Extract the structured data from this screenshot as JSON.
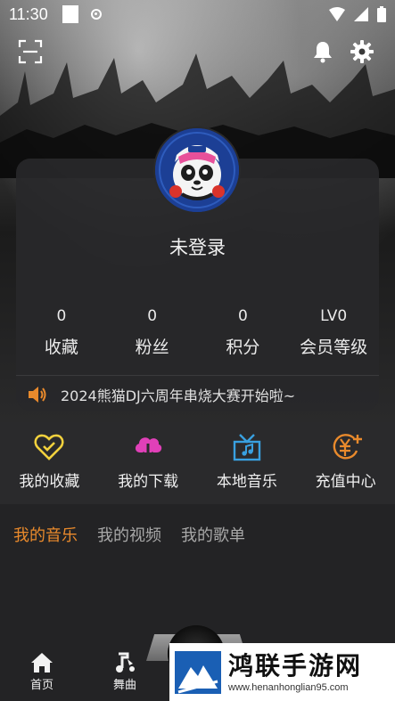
{
  "status_bar": {
    "time": "11:30"
  },
  "profile": {
    "login_status": "未登录",
    "stats": [
      {
        "value": "0",
        "label": "收藏"
      },
      {
        "value": "0",
        "label": "粉丝"
      },
      {
        "value": "0",
        "label": "积分"
      },
      {
        "value": "LV0",
        "label": "会员等级"
      }
    ],
    "notice": "2024熊猫DJ六周年串烧大赛开始啦~"
  },
  "quick_actions": [
    {
      "label": "我的收藏",
      "icon": "heart-icon",
      "color": "#f2d13d"
    },
    {
      "label": "我的下载",
      "icon": "cloud-download-icon",
      "color": "#e040b8"
    },
    {
      "label": "本地音乐",
      "icon": "gift-box-music-icon",
      "color": "#39a0e0"
    },
    {
      "label": "充值中心",
      "icon": "yuan-coin-icon",
      "color": "#e98a2c"
    }
  ],
  "tabs": [
    {
      "label": "我的音乐",
      "active": true
    },
    {
      "label": "我的视频",
      "active": false
    },
    {
      "label": "我的歌单",
      "active": false
    }
  ],
  "bottom_nav": [
    {
      "label": "首页",
      "icon": "home-icon"
    },
    {
      "label": "舞曲",
      "icon": "music-note-icon"
    }
  ],
  "watermark": {
    "title": "鸿联手游网",
    "url": "www.henanhonglian95.com"
  },
  "colors": {
    "accent": "#e98a2c",
    "background": "#232325"
  }
}
